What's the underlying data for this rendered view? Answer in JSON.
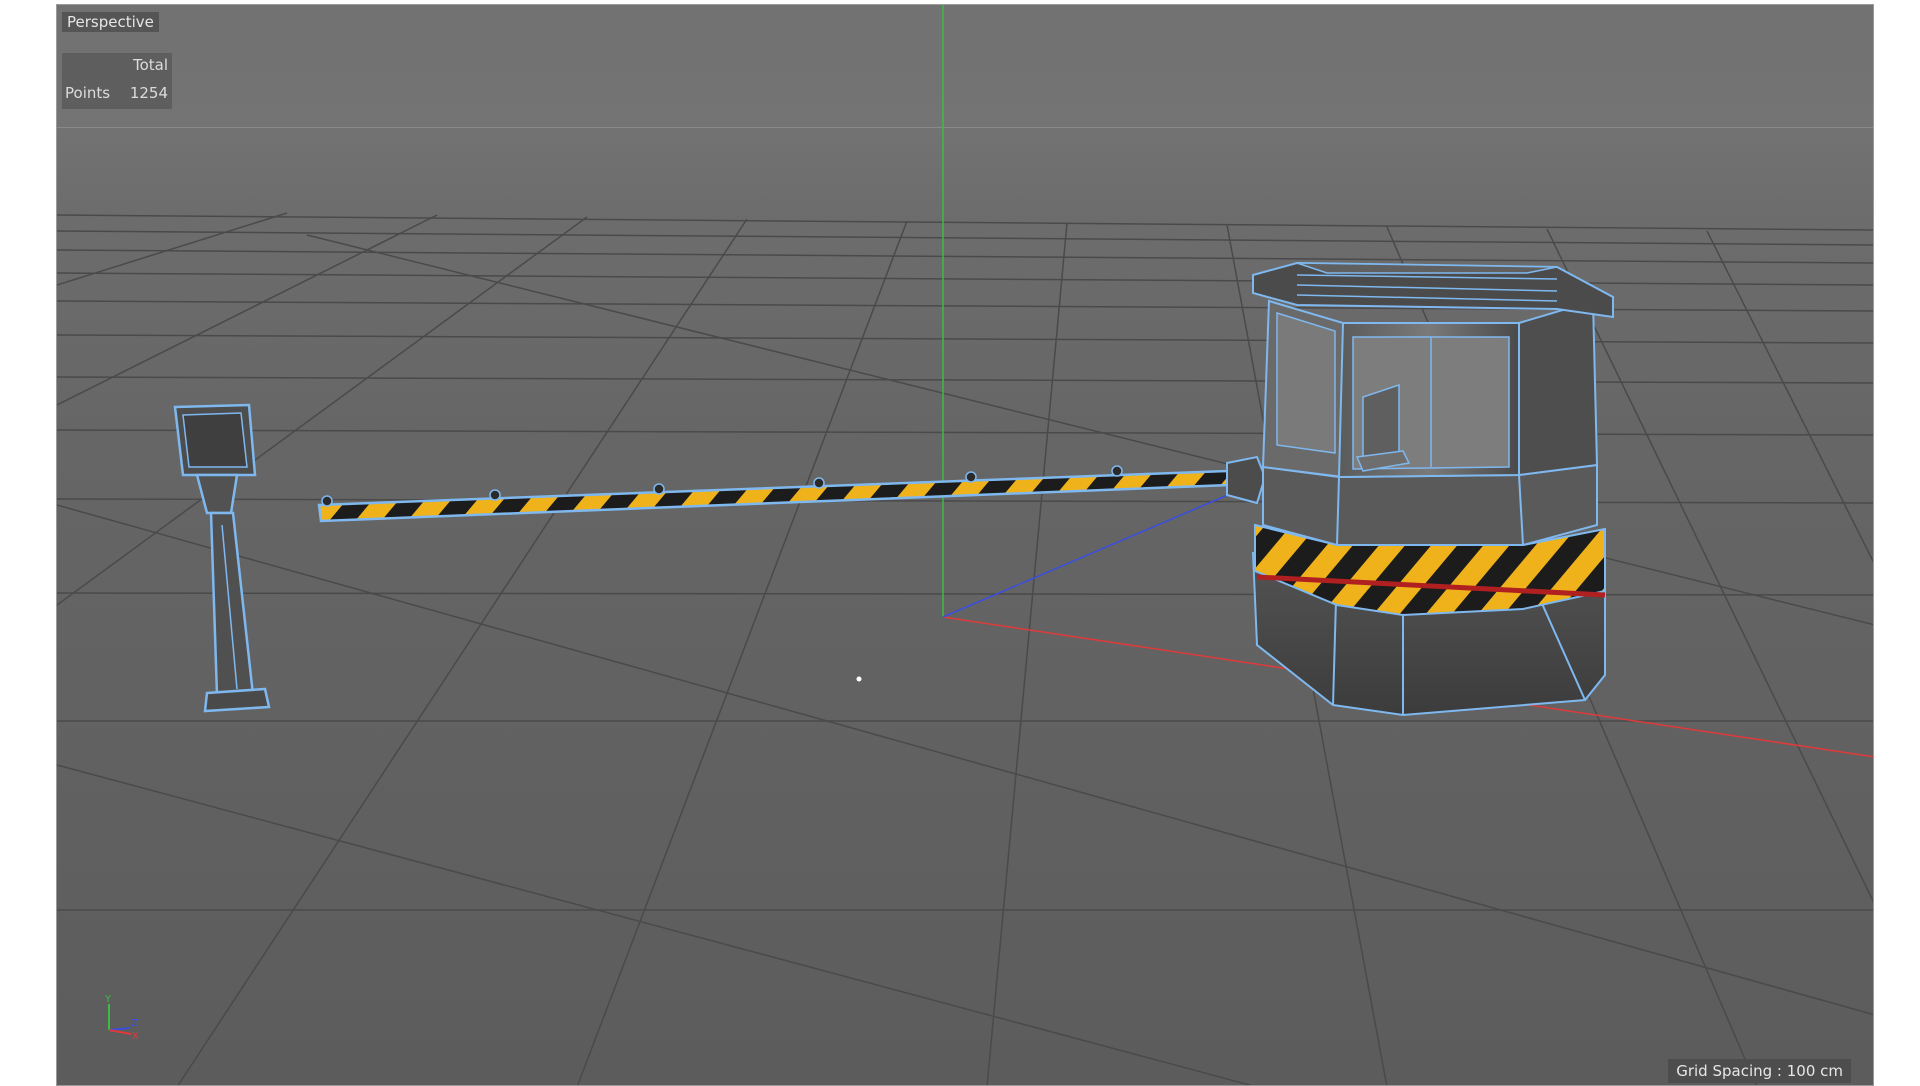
{
  "viewport": {
    "view_name": "Perspective",
    "stats": {
      "header": "Total",
      "label": "Points",
      "value": "1254"
    },
    "grid_spacing": "Grid Spacing : 100 cm",
    "axis_gizmo": {
      "y_label": "Y",
      "z_label": "Z",
      "x_label": "X"
    }
  },
  "scene": {
    "objects": [
      "gate-post",
      "barrier-arm",
      "guard-booth"
    ],
    "icons": [
      "axis-gizmo-icon"
    ]
  },
  "colors": {
    "viewport_bg": "#6a6a6a",
    "grid_line": "#4a4a4a",
    "wireframe_selection": "#7fb8ef",
    "axis_x": "#e03a3a",
    "axis_y": "#3bbd45",
    "axis_z": "#3a4fe0",
    "hazard_yellow": "#f0b21a",
    "hazard_black": "#1c1c1c"
  }
}
